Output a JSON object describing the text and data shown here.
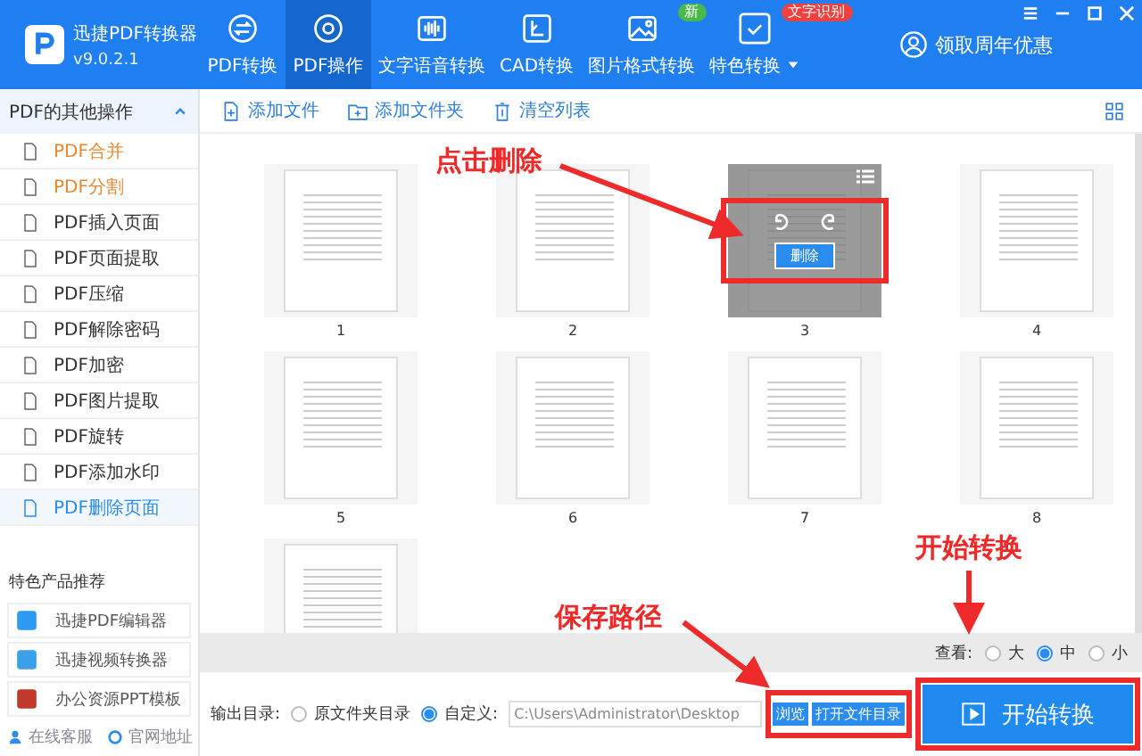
{
  "app": {
    "name": "迅捷PDF转换器",
    "version": "v9.0.2.1"
  },
  "nav_tabs": [
    {
      "label": "PDF转换",
      "selected": false
    },
    {
      "label": "PDF操作",
      "selected": true
    },
    {
      "label": "文字语音转换",
      "selected": false
    },
    {
      "label": "CAD转换",
      "selected": false
    },
    {
      "label": "图片格式转换",
      "selected": false,
      "badge": "新"
    },
    {
      "label": "特色转换",
      "selected": false,
      "badge": "文字识别",
      "dropdown": true
    }
  ],
  "promo": "领取周年优惠",
  "sidebar": {
    "title": "PDF的其他操作",
    "expanded": true,
    "items": [
      {
        "label": "PDF合并",
        "color": "#e8892e",
        "selected": false
      },
      {
        "label": "PDF分割",
        "color": "#e8892e",
        "selected": false
      },
      {
        "label": "PDF插入页面",
        "color": "#333333",
        "selected": false
      },
      {
        "label": "PDF页面提取",
        "color": "#333333",
        "selected": false
      },
      {
        "label": "PDF压缩",
        "color": "#333333",
        "selected": false
      },
      {
        "label": "PDF解除密码",
        "color": "#333333",
        "selected": false
      },
      {
        "label": "PDF加密",
        "color": "#333333",
        "selected": false
      },
      {
        "label": "PDF图片提取",
        "color": "#333333",
        "selected": false
      },
      {
        "label": "PDF旋转",
        "color": "#333333",
        "selected": false
      },
      {
        "label": "PDF添加水印",
        "color": "#333333",
        "selected": false
      },
      {
        "label": "PDF删除页面",
        "color": "#2b8cf0",
        "selected": true
      }
    ],
    "products_title": "特色产品推荐",
    "products": [
      "迅捷PDF编辑器",
      "迅捷视频转换器",
      "办公资源PPT模板"
    ],
    "footer": [
      "在线客服",
      "官网地址"
    ]
  },
  "toolbar": [
    "添加文件",
    "添加文件夹",
    "清空列表"
  ],
  "pages": [
    {
      "label": "1",
      "hovered": false
    },
    {
      "label": "2",
      "hovered": false
    },
    {
      "label": "3",
      "hovered": true,
      "delete_button": "删除"
    },
    {
      "label": "4",
      "hovered": false
    },
    {
      "label": "5",
      "hovered": false
    },
    {
      "label": "6",
      "hovered": false
    },
    {
      "label": "7",
      "hovered": false
    },
    {
      "label": "8",
      "hovered": false
    },
    {
      "hovered": false
    }
  ],
  "view": {
    "label": "查看:",
    "options": [
      {
        "label": "大",
        "selected": false
      },
      {
        "label": "中",
        "selected": true
      },
      {
        "label": "小",
        "selected": false
      }
    ]
  },
  "output": {
    "label": "输出目录:",
    "options": [
      {
        "label": "原文件夹目录",
        "selected": false
      },
      {
        "label": "自定义:",
        "selected": true
      }
    ],
    "path": "C:\\Users\\Administrator\\Desktop",
    "browse": "浏览",
    "open_folder": "打开文件目录"
  },
  "start_button": "开始转换",
  "annotations": [
    {
      "text": "点击删除"
    },
    {
      "text": "保存路径"
    },
    {
      "text": "开始转换"
    }
  ]
}
